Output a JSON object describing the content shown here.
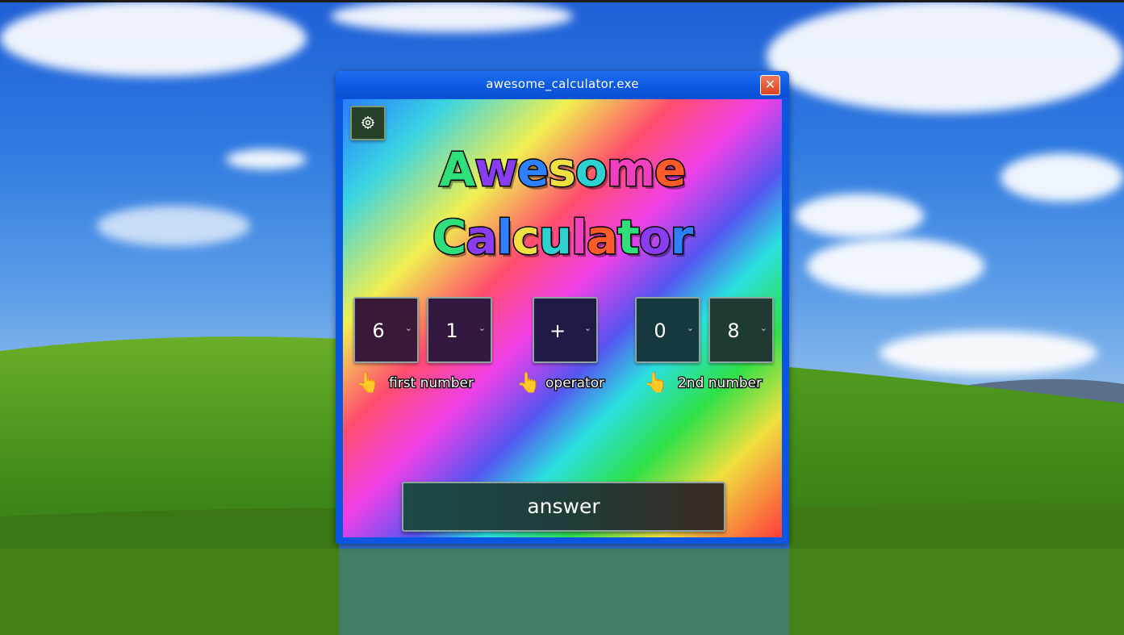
{
  "window": {
    "title": "awesome_calculator.exe",
    "close_symbol": "✕"
  },
  "app": {
    "headline_line1": "Awesome",
    "headline_line2": "Calculator",
    "first_number": {
      "digit1": "6",
      "digit2": "1",
      "label": "first number"
    },
    "operator": {
      "value": "+",
      "label": "operator"
    },
    "second_number": {
      "digit1": "0",
      "digit2": "8",
      "label": "2nd number"
    },
    "hand_symbol": "👆",
    "chevron": "⌄",
    "answer_label": "answer"
  },
  "colors": {
    "titlebar": "#0a56e0",
    "close_button": "#e05a35",
    "headline_letters": [
      "#2fe07a",
      "#8a3cf0",
      "#2f80ff",
      "#f0e040",
      "#2fd0d0",
      "#f040c0",
      "#ff5a2a"
    ]
  }
}
